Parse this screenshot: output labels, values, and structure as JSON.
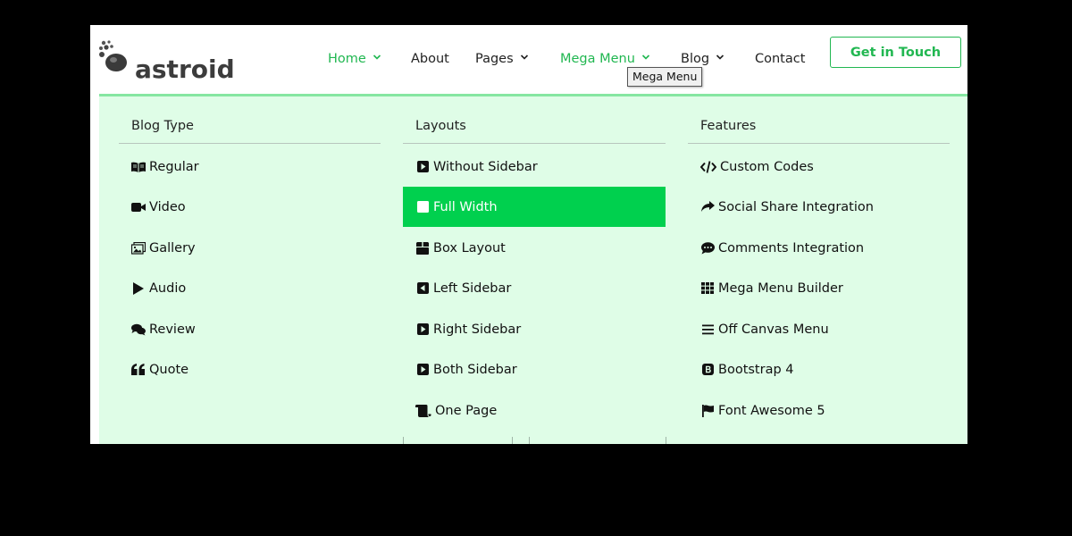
{
  "brand": {
    "logo_text": "astroid",
    "accent": "#21b751",
    "panel_bg": "#dffde7",
    "active_bg": "#00d04e"
  },
  "nav": {
    "items": [
      {
        "label": "Home",
        "has_chevron": true,
        "active": true
      },
      {
        "label": "About",
        "has_chevron": false,
        "active": false
      },
      {
        "label": "Pages",
        "has_chevron": true,
        "active": false
      },
      {
        "label": "Mega Menu",
        "has_chevron": true,
        "active": true
      },
      {
        "label": "Blog",
        "has_chevron": true,
        "active": false
      },
      {
        "label": "Contact",
        "has_chevron": false,
        "active": false
      }
    ],
    "cta_label": "Get in Touch"
  },
  "tooltip": {
    "text": "Mega Menu"
  },
  "mega": {
    "columns": [
      {
        "title": "Blog Type",
        "items": [
          {
            "label": "Regular",
            "icon": "book-open-icon"
          },
          {
            "label": "Video",
            "icon": "video-camera-icon"
          },
          {
            "label": "Gallery",
            "icon": "images-icon"
          },
          {
            "label": "Audio",
            "icon": "play-icon"
          },
          {
            "label": "Review",
            "icon": "comments-icon"
          },
          {
            "label": "Quote",
            "icon": "quote-left-icon"
          }
        ]
      },
      {
        "title": "Layouts",
        "items": [
          {
            "label": "Without Sidebar",
            "icon": "caret-square-right-icon"
          },
          {
            "label": "Full Width",
            "icon": "square-icon",
            "active": true
          },
          {
            "label": "Box Layout",
            "icon": "box-icon"
          },
          {
            "label": "Left Sidebar",
            "icon": "caret-square-left-icon"
          },
          {
            "label": "Right Sidebar",
            "icon": "caret-square-right-icon"
          },
          {
            "label": "Both Sidebar",
            "icon": "caret-square-right-icon"
          },
          {
            "label": "One Page",
            "icon": "scroll-icon"
          }
        ]
      },
      {
        "title": "Features",
        "items": [
          {
            "label": "Custom Codes",
            "icon": "code-icon"
          },
          {
            "label": "Social Share Integration",
            "icon": "share-icon"
          },
          {
            "label": "Comments Integration",
            "icon": "comment-dots-icon"
          },
          {
            "label": "Mega Menu Builder",
            "icon": "th-icon"
          },
          {
            "label": "Off Canvas Menu",
            "icon": "bars-icon"
          },
          {
            "label": "Bootstrap 4",
            "icon": "bootstrap-icon"
          },
          {
            "label": "Font Awesome 5",
            "icon": "flag-icon"
          }
        ]
      }
    ]
  }
}
